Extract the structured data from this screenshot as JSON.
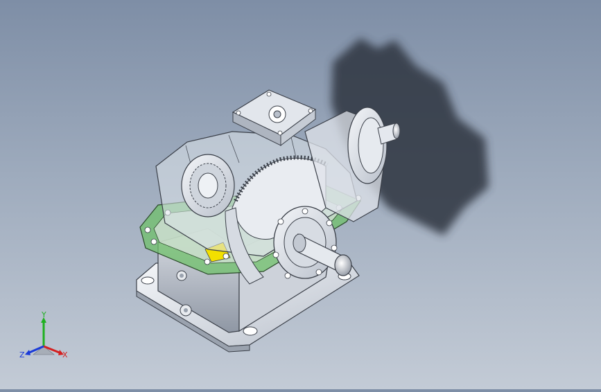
{
  "viewport": {
    "background_top": "#7e8ea6",
    "background_bottom": "#c3cbd6"
  },
  "model": {
    "description_icon": "gear-reducer-model",
    "housing_color": "#dfe3ea",
    "flange_color": "#6fc06a",
    "shadow_color": "#2f3440",
    "key_color": "#f2e000"
  },
  "triad": {
    "x_label": "X",
    "y_label": "Y",
    "z_label": "Z",
    "x_color": "#d42020",
    "y_color": "#1fb020",
    "z_color": "#1a3ad8"
  }
}
